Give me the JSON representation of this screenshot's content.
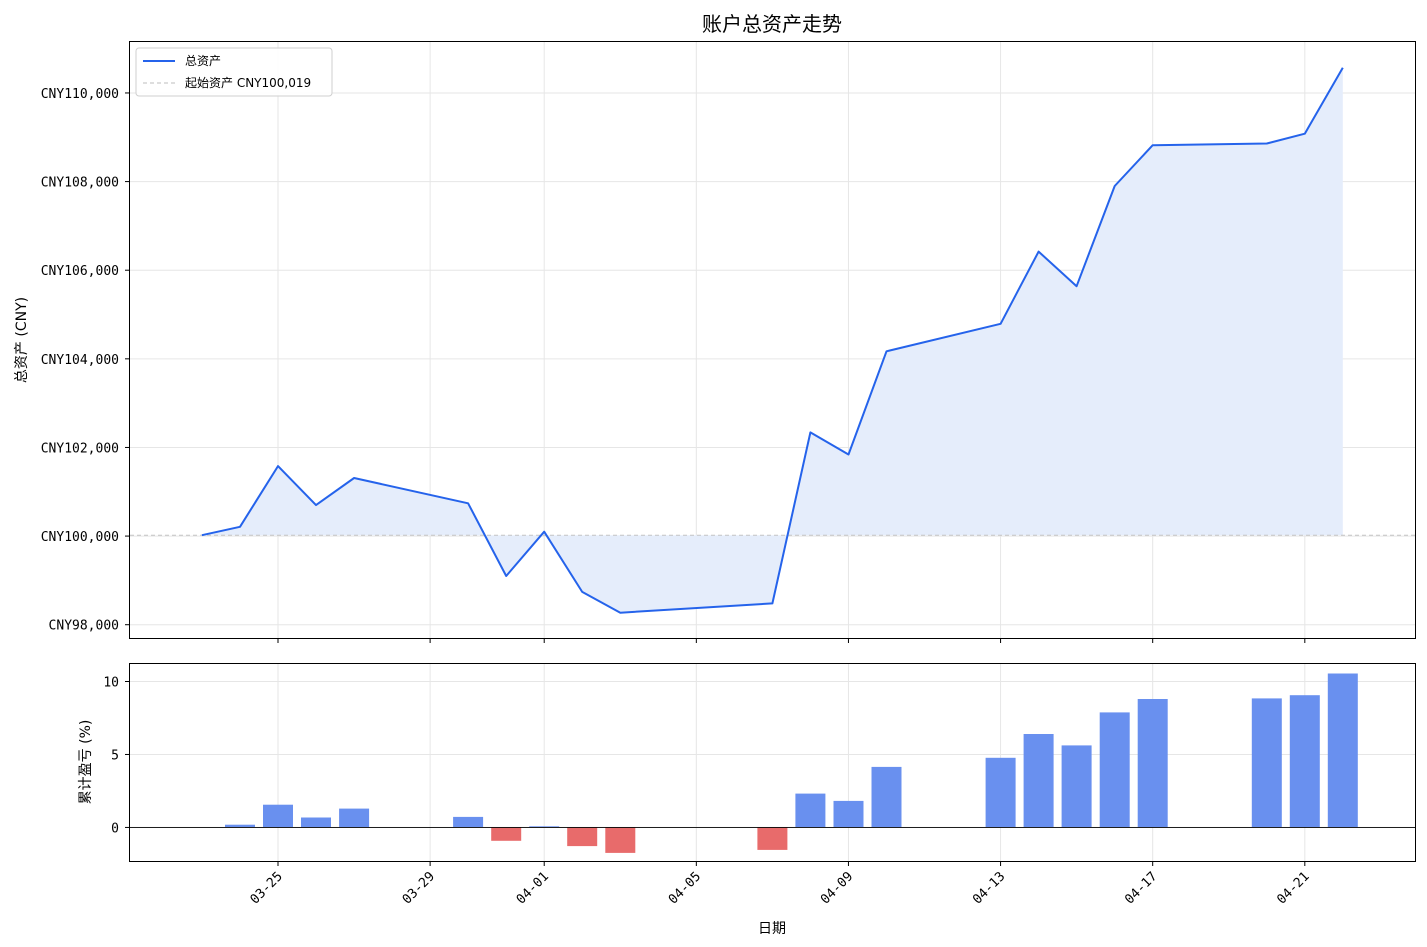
{
  "chart_data": [
    {
      "type": "area",
      "title": "账户总资产走势",
      "ylabel": "总资产 (CNY)",
      "xlabel": "",
      "ylim": [
        97700,
        111150
      ],
      "yticks": [
        98000,
        100000,
        102000,
        104000,
        106000,
        108000,
        110000
      ],
      "ytick_labels": [
        "CNY98,000",
        "CNY100,000",
        "CNY102,000",
        "CNY104,000",
        "CNY106,000",
        "CNY108,000",
        "CNY110,000"
      ],
      "grid": true,
      "legend_position": "upper-left",
      "baseline": {
        "value": 100019,
        "label": "起始资产 CNY100,019"
      },
      "series": [
        {
          "name": "总资产",
          "color": "#2563eb",
          "fill": "#e5edfb",
          "points": [
            {
              "x": "2026-03-23",
              "y": 100019
            },
            {
              "x": "2026-03-24",
              "y": 100210
            },
            {
              "x": "2026-03-25",
              "y": 101580
            },
            {
              "x": "2026-03-26",
              "y": 100700
            },
            {
              "x": "2026-03-27",
              "y": 101310
            },
            {
              "x": "2026-03-30",
              "y": 100740
            },
            {
              "x": "2026-03-31",
              "y": 99100
            },
            {
              "x": "2026-04-01",
              "y": 100100
            },
            {
              "x": "2026-04-02",
              "y": 98740
            },
            {
              "x": "2026-04-03",
              "y": 98270
            },
            {
              "x": "2026-04-07",
              "y": 98480
            },
            {
              "x": "2026-04-08",
              "y": 102340
            },
            {
              "x": "2026-04-09",
              "y": 101840
            },
            {
              "x": "2026-04-10",
              "y": 104170
            },
            {
              "x": "2026-04-13",
              "y": 104790
            },
            {
              "x": "2026-04-14",
              "y": 106420
            },
            {
              "x": "2026-04-15",
              "y": 105640
            },
            {
              "x": "2026-04-16",
              "y": 107900
            },
            {
              "x": "2026-04-17",
              "y": 108820
            },
            {
              "x": "2026-04-20",
              "y": 108860
            },
            {
              "x": "2026-04-21",
              "y": 109080
            },
            {
              "x": "2026-04-22",
              "y": 110570
            }
          ]
        }
      ]
    },
    {
      "type": "bar",
      "ylabel": "累计盈亏 (%)",
      "xlabel": "日期",
      "ylim": [
        -2.3,
        11.2
      ],
      "yticks": [
        0,
        5,
        10
      ],
      "ytick_labels": [
        "0",
        "5",
        "10"
      ],
      "grid": true,
      "positive_color": "#6990ef",
      "negative_color": "#e86b6b",
      "x_ticks": [
        {
          "x": "2026-03-25",
          "label": "03-25"
        },
        {
          "x": "2026-03-29",
          "label": "03-29"
        },
        {
          "x": "2026-04-01",
          "label": "04-01"
        },
        {
          "x": "2026-04-05",
          "label": "04-05"
        },
        {
          "x": "2026-04-09",
          "label": "04-09"
        },
        {
          "x": "2026-04-13",
          "label": "04-13"
        },
        {
          "x": "2026-04-17",
          "label": "04-17"
        },
        {
          "x": "2026-04-21",
          "label": "04-21"
        }
      ],
      "bars": [
        {
          "x": "2026-03-24",
          "value": 0.19
        },
        {
          "x": "2026-03-25",
          "value": 1.56
        },
        {
          "x": "2026-03-26",
          "value": 0.68
        },
        {
          "x": "2026-03-27",
          "value": 1.29
        },
        {
          "x": "2026-03-30",
          "value": 0.72
        },
        {
          "x": "2026-03-31",
          "value": -0.92
        },
        {
          "x": "2026-04-01",
          "value": 0.08
        },
        {
          "x": "2026-04-02",
          "value": -1.28
        },
        {
          "x": "2026-04-03",
          "value": -1.75
        },
        {
          "x": "2026-04-07",
          "value": -1.54
        },
        {
          "x": "2026-04-08",
          "value": 2.32
        },
        {
          "x": "2026-04-09",
          "value": 1.82
        },
        {
          "x": "2026-04-10",
          "value": 4.15
        },
        {
          "x": "2026-04-13",
          "value": 4.77
        },
        {
          "x": "2026-04-14",
          "value": 6.4
        },
        {
          "x": "2026-04-15",
          "value": 5.62
        },
        {
          "x": "2026-04-16",
          "value": 7.88
        },
        {
          "x": "2026-04-17",
          "value": 8.8
        },
        {
          "x": "2026-04-20",
          "value": 8.84
        },
        {
          "x": "2026-04-21",
          "value": 9.06
        },
        {
          "x": "2026-04-22",
          "value": 10.55
        }
      ]
    }
  ]
}
